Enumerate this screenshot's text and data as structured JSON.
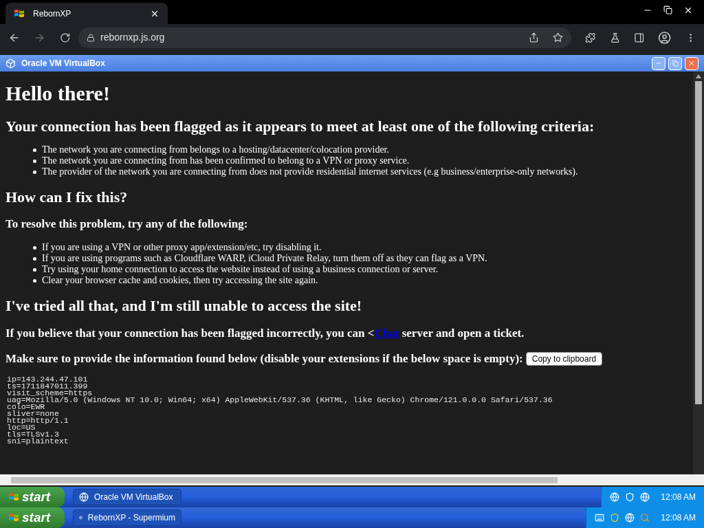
{
  "browser": {
    "tab": {
      "title": "RebornXP",
      "selected": true
    },
    "address": "rebornxp.js.org"
  },
  "vm_window": {
    "title": "Oracle VM VirtualBox"
  },
  "page": {
    "heading": "Hello there!",
    "subheading": "Your connection has been flagged as it appears to meet at least one of the following criteria:",
    "criteria": [
      "The network you are connecting from belongs to a hosting/datacenter/colocation provider.",
      "The network you are connecting from has been confirmed to belong to a VPN or proxy service.",
      "The provider of the network you are connecting from does not provide residential internet services (e.g business/enterprise-only networks)."
    ],
    "fix_heading": "How can I fix this?",
    "fix_intro": "To resolve this problem, try any of the following:",
    "fixes": [
      "If you are using a VPN or other proxy app/extension/etc, try disabling it.",
      "If you are using programs such as Cloudflare WARP, iCloud Private Relay, turn them off as they can flag as a VPN.",
      "Try using your home connection to access the website instead of using a business connection or server.",
      "Clear your browser cache and cookies, then try accessing the site again."
    ],
    "tried_heading": "I've tried all that, and I'm still unable to access the site!",
    "ticket": {
      "before": "If you believe that your connection has been flagged incorrectly, you can <",
      "link": "Chat",
      "after": " server and open a ticket."
    },
    "info_prompt": "Make sure to provide the information found below (disable your extensions if the below space is empty):",
    "copy_button": "Copy to clipboard",
    "trace": [
      "ip=143.244.47.101",
      "ts=1711847011.399",
      "visit_scheme=https",
      "uag=Mozilla/5.0 (Windows NT 10.0; Win64; x64) AppleWebKit/537.36 (KHTML, like Gecko) Chrome/121.0.0.0 Safari/537.36",
      "colo=EWR",
      "sliver=none",
      "http=http/1.1",
      "loc=US",
      "tls=TLSv1.3",
      "sni=plaintext"
    ]
  },
  "inner_taskbar": {
    "start": "start",
    "tasks": [
      {
        "label": "Oracle VM VirtualBox",
        "selected": true
      }
    ],
    "clock": "12:08 AM"
  },
  "outer_taskbar": {
    "start": "start",
    "tasks": [
      {
        "label": "RebornXP - Supermium",
        "selected": true
      }
    ],
    "clock": "12:08 AM"
  }
}
